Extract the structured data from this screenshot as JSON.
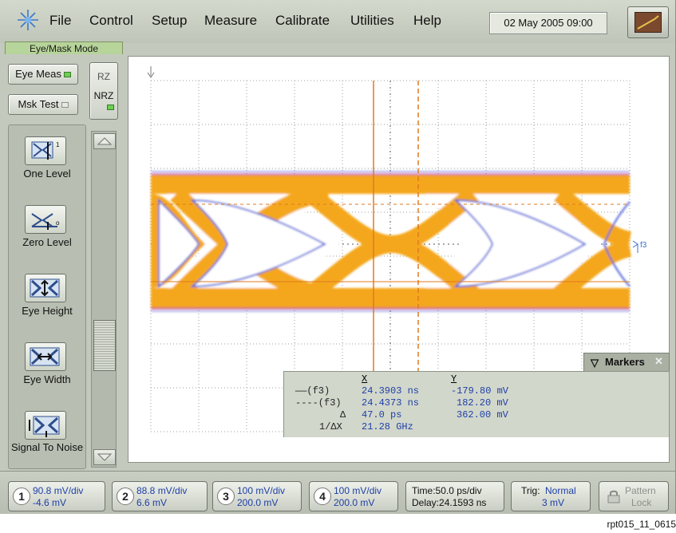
{
  "menu": {
    "file": "File",
    "control": "Control",
    "setup": "Setup",
    "measure": "Measure",
    "calibrate": "Calibrate",
    "utilities": "Utilities",
    "help": "Help"
  },
  "datetime": "02 May 2005  09:00",
  "mode_tab": "Eye/Mask Mode",
  "mode_buttons": {
    "eye_meas": "Eye Meas",
    "msk_test": "Msk Test",
    "rz": "RZ",
    "nrz": "NRZ"
  },
  "tools": [
    {
      "label": "One Level",
      "icon": "one-level-icon"
    },
    {
      "label": "Zero Level",
      "icon": "zero-level-icon"
    },
    {
      "label": "Eye Height",
      "icon": "eye-height-icon"
    },
    {
      "label": "Eye Width",
      "icon": "eye-width-icon"
    },
    {
      "label": "Signal To Noise",
      "icon": "signal-to-noise-icon"
    }
  ],
  "marker_side_label": "f3",
  "markers": {
    "tab_label": "Markers",
    "header_x": "X",
    "header_y": "Y",
    "rows": [
      {
        "label": "——(f3)",
        "x": "24.3903 ns",
        "y": "-179.80 mV"
      },
      {
        "label": "----(f3)",
        "x": "24.4373 ns",
        "y": "182.20 mV"
      },
      {
        "label": "Δ",
        "x": "47.0 ps",
        "y": "362.00 mV"
      },
      {
        "label": "1/ΔX",
        "x": "21.28 GHz",
        "y": ""
      }
    ]
  },
  "channels": [
    {
      "num": "1",
      "scale": "90.8 mV/div",
      "offset": "-4.6 mV"
    },
    {
      "num": "2",
      "scale": "88.8 mV/div",
      "offset": "6.6 mV"
    },
    {
      "num": "3",
      "scale": "100 mV/div",
      "offset": "200.0 mV"
    },
    {
      "num": "4",
      "scale": "100 mV/div",
      "offset": "200.0 mV"
    }
  ],
  "timebase": {
    "time": "Time:50.0 ps/div",
    "delay": "Delay:24.1593 ns"
  },
  "trigger": {
    "label": "Trig:",
    "mode": "Normal",
    "level": "3 mV"
  },
  "pattern_lock": {
    "line1": "Pattern",
    "line2": "Lock"
  },
  "figure_id": "rpt015_11_0615",
  "colors": {
    "marker_orange": "#e07a1f",
    "text_blue": "#1e3fa6",
    "panel_bg": "#c3c9bd"
  }
}
